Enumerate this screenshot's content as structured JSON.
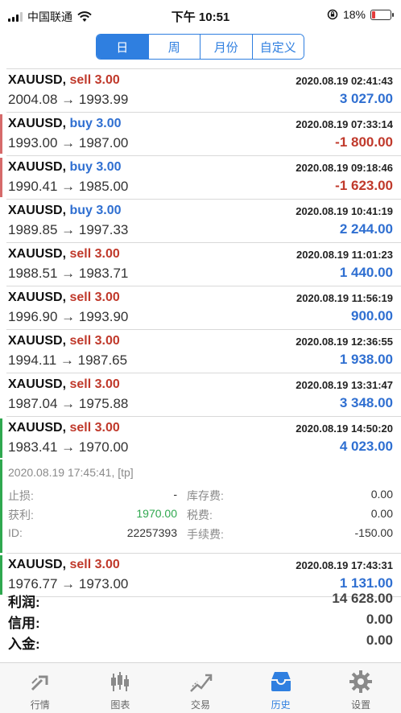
{
  "status_bar": {
    "carrier": "中国联通",
    "time": "下午 10:51",
    "battery": "18%",
    "battery_level": 0.18
  },
  "segments": [
    {
      "label": "日",
      "active": true
    },
    {
      "label": "周",
      "active": false
    },
    {
      "label": "月份",
      "active": false
    },
    {
      "label": "自定义",
      "active": false
    }
  ],
  "colors": {
    "accent": "#2f7fe0",
    "sell": "#c0392b",
    "buy": "#2f6fd1",
    "profit_positive": "#2f6fd1",
    "profit_negative": "#c0392b",
    "bar_green": "#2fa84f",
    "bar_red": "#d66a6a"
  },
  "trades": [
    {
      "symbol": "XAUUSD,",
      "side": "sell",
      "volume": "3.00",
      "time": "2020.08.19 02:41:43",
      "prices": "2004.08 → 1993.99",
      "profit": "3 027.00",
      "negative": false,
      "marker": ""
    },
    {
      "symbol": "XAUUSD,",
      "side": "buy",
      "volume": "3.00",
      "time": "2020.08.19 07:33:14",
      "prices": "1993.00 → 1987.00",
      "profit": "-1 800.00",
      "negative": true,
      "marker": "red"
    },
    {
      "symbol": "XAUUSD,",
      "side": "buy",
      "volume": "3.00",
      "time": "2020.08.19 09:18:46",
      "prices": "1990.41 → 1985.00",
      "profit": "-1 623.00",
      "negative": true,
      "marker": "red"
    },
    {
      "symbol": "XAUUSD,",
      "side": "buy",
      "volume": "3.00",
      "time": "2020.08.19 10:41:19",
      "prices": "1989.85 → 1997.33",
      "profit": "2 244.00",
      "negative": false,
      "marker": ""
    },
    {
      "symbol": "XAUUSD,",
      "side": "sell",
      "volume": "3.00",
      "time": "2020.08.19 11:01:23",
      "prices": "1988.51 → 1983.71",
      "profit": "1 440.00",
      "negative": false,
      "marker": ""
    },
    {
      "symbol": "XAUUSD,",
      "side": "sell",
      "volume": "3.00",
      "time": "2020.08.19 11:56:19",
      "prices": "1996.90 → 1993.90",
      "profit": "900.00",
      "negative": false,
      "marker": ""
    },
    {
      "symbol": "XAUUSD,",
      "side": "sell",
      "volume": "3.00",
      "time": "2020.08.19 12:36:55",
      "prices": "1994.11 → 1987.65",
      "profit": "1 938.00",
      "negative": false,
      "marker": ""
    },
    {
      "symbol": "XAUUSD,",
      "side": "sell",
      "volume": "3.00",
      "time": "2020.08.19 13:31:47",
      "prices": "1987.04 → 1975.88",
      "profit": "3 348.00",
      "negative": false,
      "marker": ""
    },
    {
      "symbol": "XAUUSD,",
      "side": "sell",
      "volume": "3.00",
      "time": "2020.08.19 14:50:20",
      "prices": "1983.41 → 1970.00",
      "profit": "4 023.00",
      "negative": false,
      "marker": "green"
    }
  ],
  "expanded": {
    "comment": "2020.08.19 17:45:41, [tp]",
    "sl_label": "止损:",
    "sl_value": "-",
    "swap_label": "库存费:",
    "swap_value": "0.00",
    "tp_label": "获利:",
    "tp_value": "1970.00",
    "tax_label": "税费:",
    "tax_value": "0.00",
    "id_label": "ID:",
    "id_value": "22257393",
    "commission_label": "手续费:",
    "commission_value": "-150.00"
  },
  "last_trade": {
    "symbol": "XAUUSD,",
    "side": "sell",
    "volume": "3.00",
    "time": "2020.08.19 17:43:31",
    "prices": "1976.77 → 1973.00",
    "profit": "1 131.00",
    "negative": false,
    "marker": "green"
  },
  "summary": [
    {
      "label": "利润:",
      "value": "14 628.00"
    },
    {
      "label": "信用:",
      "value": "0.00"
    },
    {
      "label": "入金:",
      "value": "0.00"
    }
  ],
  "tabs": [
    {
      "label": "行情",
      "icon": "quotes-icon",
      "active": false
    },
    {
      "label": "图表",
      "icon": "chart-icon",
      "active": false
    },
    {
      "label": "交易",
      "icon": "trade-icon",
      "active": false
    },
    {
      "label": "历史",
      "icon": "history-icon",
      "active": true
    },
    {
      "label": "设置",
      "icon": "gear-icon",
      "active": false
    }
  ]
}
